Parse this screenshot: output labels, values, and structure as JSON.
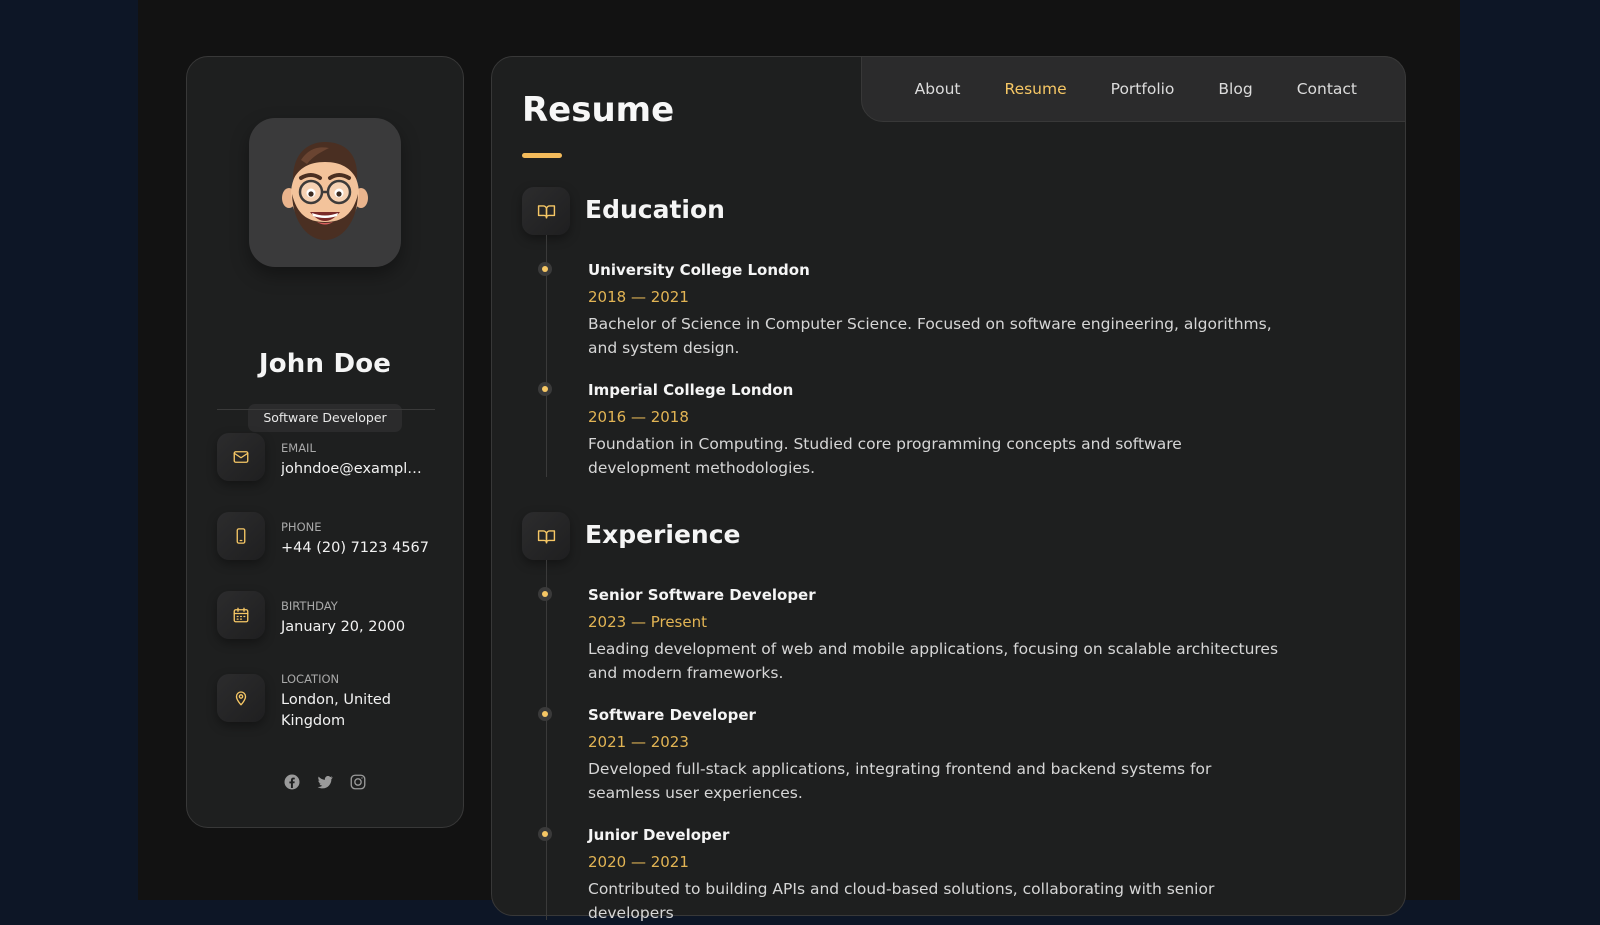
{
  "profile": {
    "name": "John Doe",
    "title": "Software Developer"
  },
  "contacts": [
    {
      "label": "EMAIL",
      "value": "johndoe@example...",
      "icon": "mail-icon"
    },
    {
      "label": "PHONE",
      "value": "+44 (20) 7123 4567",
      "icon": "phone-icon"
    },
    {
      "label": "BIRTHDAY",
      "value": "January 20, 2000",
      "icon": "calendar-icon"
    },
    {
      "label": "LOCATION",
      "value": "London, United Kingdom",
      "icon": "location-pin-icon"
    }
  ],
  "socials": [
    "facebook-icon",
    "twitter-icon",
    "instagram-icon"
  ],
  "nav": {
    "items": [
      {
        "label": "About",
        "active": false
      },
      {
        "label": "Resume",
        "active": true
      },
      {
        "label": "Portfolio",
        "active": false
      },
      {
        "label": "Blog",
        "active": false
      },
      {
        "label": "Contact",
        "active": false
      }
    ]
  },
  "page": {
    "title": "Resume"
  },
  "sections": [
    {
      "title": "Education",
      "icon": "book-open-icon",
      "items": [
        {
          "title": "University College London",
          "date": "2018 — 2021",
          "desc": "Bachelor of Science in Computer Science. Focused on software engineering, algorithms, and system design."
        },
        {
          "title": "Imperial College London",
          "date": "2016 — 2018",
          "desc": "Foundation in Computing. Studied core programming concepts and software development methodologies."
        }
      ]
    },
    {
      "title": "Experience",
      "icon": "book-open-icon",
      "items": [
        {
          "title": "Senior Software Developer",
          "date": "2023 — Present",
          "desc": "Leading development of web and mobile applications, focusing on scalable architectures and modern frameworks."
        },
        {
          "title": "Software Developer",
          "date": "2021 — 2023",
          "desc": "Developed full-stack applications, integrating frontend and backend systems for seamless user experiences."
        },
        {
          "title": "Junior Developer",
          "date": "2020 — 2021",
          "desc": "Contributed to building APIs and cloud-based solutions, collaborating with senior developers"
        }
      ]
    }
  ],
  "colors": {
    "accent": "#f6c765",
    "background": "#0d1626",
    "card": "#1e1f1f"
  }
}
